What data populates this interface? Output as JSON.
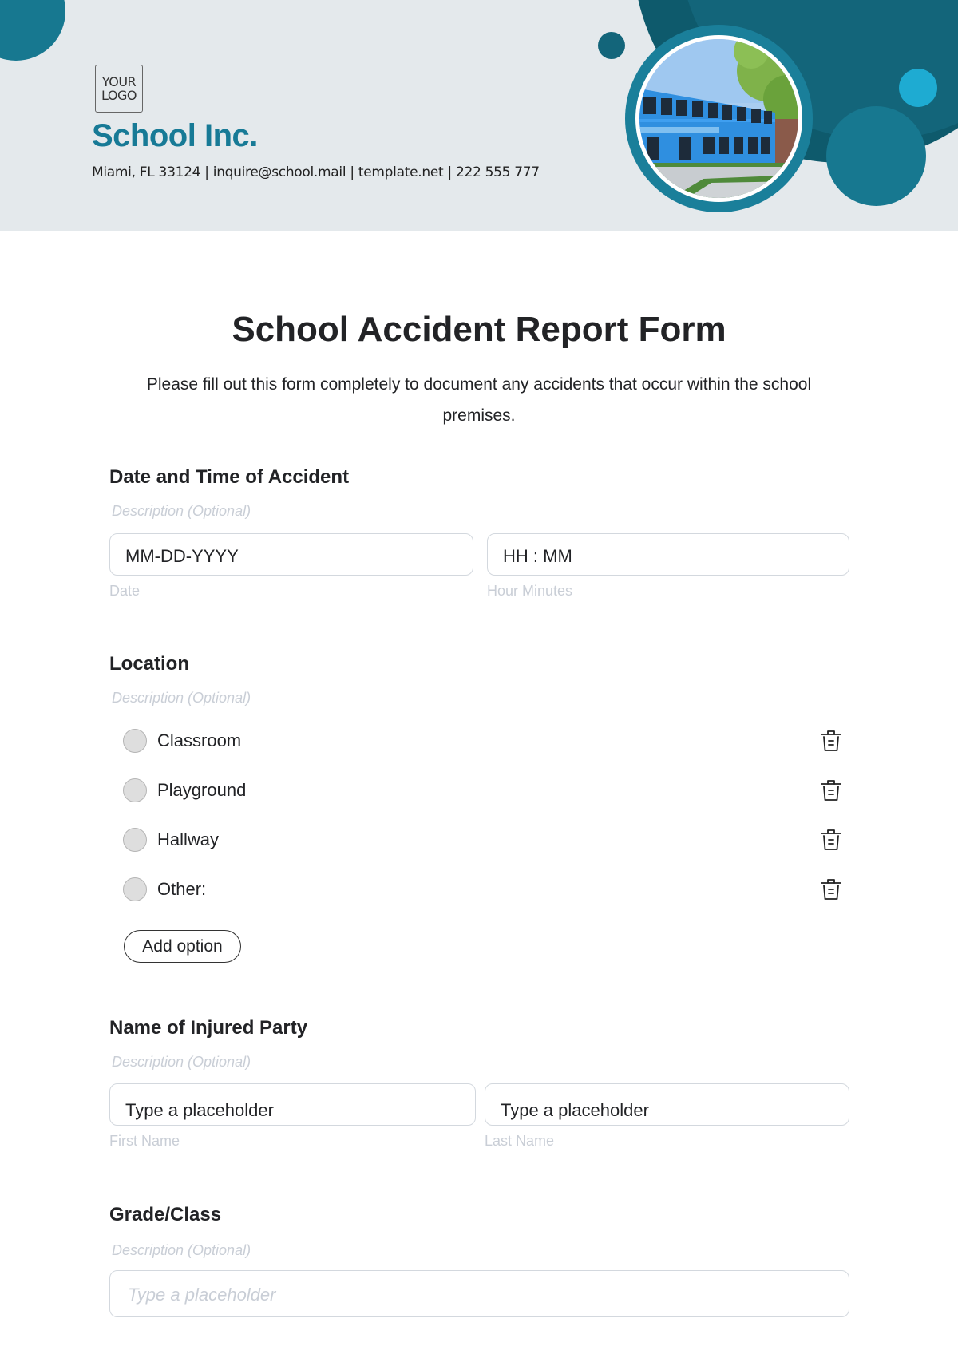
{
  "header": {
    "logo_line1": "YOUR",
    "logo_line2": "LOGO",
    "company_name": "School Inc.",
    "contact_line": "Miami, FL 33124 | inquire@school.mail | template.net | 222 555 777",
    "colors": {
      "background": "#e4e9ec",
      "brand": "#177a96",
      "dark_teal": "#0e5a6c",
      "teal": "#13657a",
      "mid_teal": "#177890",
      "light_blue": "#1eabd2"
    },
    "photo_alt": "school-building-photo"
  },
  "form": {
    "title": "School Accident Report Form",
    "subtitle": "Please fill out this form completely to document any accidents that occur within the school premises.",
    "sections": [
      {
        "heading": "Date and Time of Accident",
        "description": "Description (Optional)",
        "fields": [
          {
            "value": "MM-DD-YYYY",
            "label": "Date"
          },
          {
            "value": "HH : MM",
            "label": "Hour Minutes"
          }
        ]
      },
      {
        "heading": "Location",
        "description": "Description (Optional)",
        "options": [
          {
            "label": "Classroom",
            "selected": false
          },
          {
            "label": "Playground",
            "selected": false
          },
          {
            "label": "Hallway",
            "selected": false
          },
          {
            "label": "Other:",
            "selected": false
          }
        ],
        "add_option_label": "Add option"
      },
      {
        "heading": "Name of Injured Party",
        "description": "Description (Optional)",
        "fields": [
          {
            "value": "Type a placeholder",
            "label": "First Name"
          },
          {
            "value": "Type a placeholder",
            "label": "Last Name"
          }
        ]
      },
      {
        "heading": "Grade/Class",
        "description": "Description (Optional)",
        "fields": [
          {
            "placeholder": "Type a placeholder"
          }
        ]
      }
    ]
  }
}
